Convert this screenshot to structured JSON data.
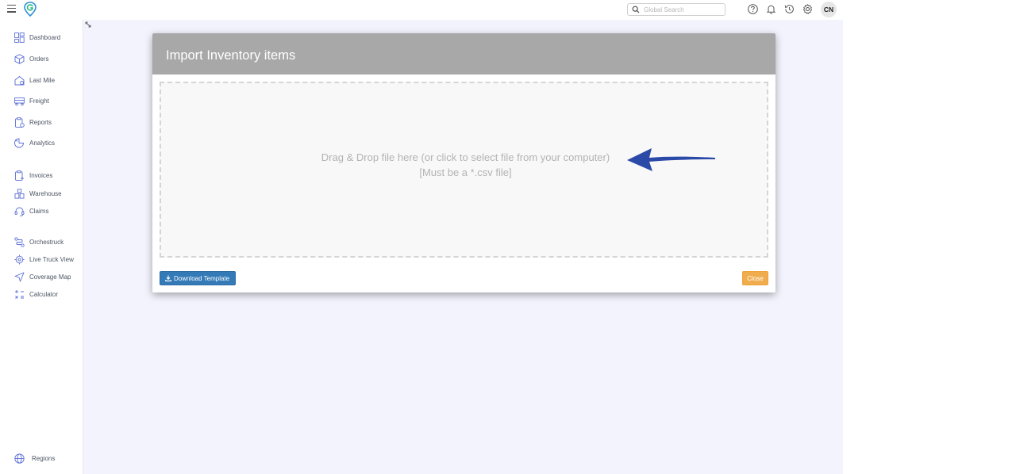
{
  "search": {
    "placeholder": "Global Search"
  },
  "user": {
    "initials": "CN"
  },
  "sidebar": {
    "group1": [
      {
        "label": "Dashboard",
        "icon": "dashboard-icon"
      },
      {
        "label": "Orders",
        "icon": "box-icon"
      },
      {
        "label": "Last Mile",
        "icon": "last-mile-icon"
      },
      {
        "label": "Freight",
        "icon": "truck-icon"
      },
      {
        "label": "Reports",
        "icon": "clipboard-icon"
      },
      {
        "label": "Analytics",
        "icon": "analytics-icon"
      }
    ],
    "group2": [
      {
        "label": "Invoices",
        "icon": "invoice-icon"
      },
      {
        "label": "Warehouse",
        "icon": "warehouse-icon"
      },
      {
        "label": "Claims",
        "icon": "headset-icon"
      }
    ],
    "group3": [
      {
        "label": "Orchestruck",
        "icon": "route-icon"
      },
      {
        "label": "Live Truck View",
        "icon": "target-icon"
      },
      {
        "label": "Coverage Map",
        "icon": "navigation-icon"
      },
      {
        "label": "Calculator",
        "icon": "calculator-icon"
      }
    ],
    "bottom": {
      "label": "Regions",
      "icon": "globe-icon"
    }
  },
  "modal": {
    "title": "Import Inventory items",
    "dropzone_line1": "Drag & Drop file here (or click to select file from your computer)",
    "dropzone_line2": "[Must be a *.csv file]",
    "download_label": "Download Template",
    "close_label": "Close"
  },
  "colors": {
    "accent": "#5b6fd6",
    "download_button": "#337ab7",
    "close_button": "#f0ad4e",
    "arrow": "#2b4aa8",
    "modal_header": "#a8a8a8",
    "background": "#f3f3fd"
  }
}
